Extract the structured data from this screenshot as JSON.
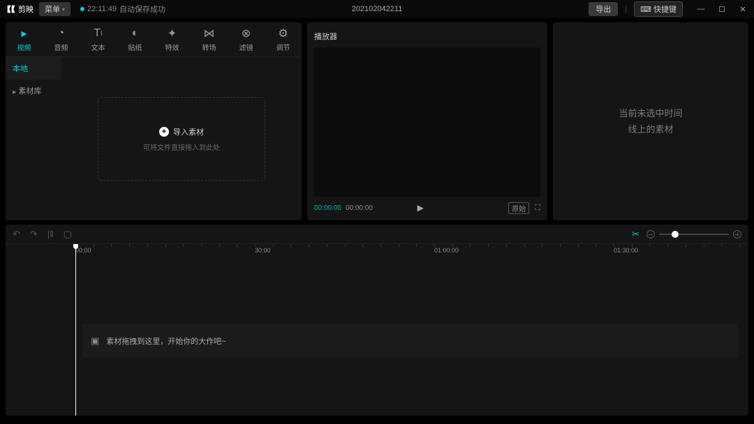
{
  "titlebar": {
    "app_name": "剪映",
    "menu_label": "菜单",
    "autosave_time": "22:11:49",
    "autosave_text": "自动保存成功",
    "project_title": "202102042211",
    "export_label": "导出",
    "shortcut_label": "快捷键"
  },
  "tool_tabs": [
    {
      "icon": "video-icon",
      "label": "视频"
    },
    {
      "icon": "audio-icon",
      "label": "音频"
    },
    {
      "icon": "text-icon",
      "label": "文本"
    },
    {
      "icon": "sticker-icon",
      "label": "贴纸"
    },
    {
      "icon": "fx-icon",
      "label": "特效"
    },
    {
      "icon": "transition-icon",
      "label": "转场"
    },
    {
      "icon": "filter-icon",
      "label": "滤镜"
    },
    {
      "icon": "adjust-icon",
      "label": "调节"
    }
  ],
  "media_side": {
    "local": "本地",
    "library": "素材库"
  },
  "import_box": {
    "label": "导入素材",
    "hint": "可将文件直接拖入到此处"
  },
  "player": {
    "title": "播放器",
    "current": "00:00:00",
    "duration": "00:00:00",
    "original_label": "原始"
  },
  "inspector": {
    "empty_line1": "当前未选中时间",
    "empty_line2": "线上的素材"
  },
  "timeline": {
    "ruler": [
      "00:00",
      "30:00",
      "01:00:00",
      "01:30:00"
    ],
    "track_hint": "素材拖拽到这里，开始你的大作吧~"
  }
}
